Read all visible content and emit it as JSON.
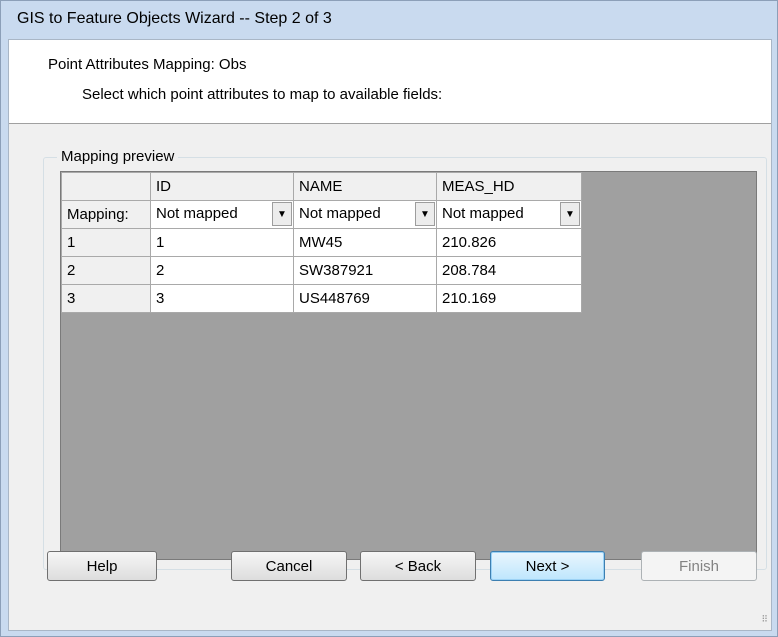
{
  "window": {
    "title": "GIS to Feature Objects Wizard -- Step 2 of 3"
  },
  "header": {
    "heading": "Point Attributes Mapping:  Obs",
    "subheading": "Select which point attributes to map to available fields:"
  },
  "group": {
    "label": "Mapping preview"
  },
  "grid": {
    "columns": [
      "",
      "ID",
      "NAME",
      "MEAS_HD"
    ],
    "mapping_label": "Mapping:",
    "mapping_values": [
      "Not mapped",
      "Not mapped",
      "Not mapped"
    ],
    "rows": [
      [
        "1",
        "1",
        "MW45",
        "210.826"
      ],
      [
        "2",
        "2",
        "SW387921",
        "208.784"
      ],
      [
        "3",
        "3",
        "US448769",
        "210.169"
      ]
    ]
  },
  "buttons": {
    "help": "Help",
    "cancel": "Cancel",
    "back": "< Back",
    "next": "Next >",
    "finish": "Finish"
  },
  "icons": {
    "dropdown": "chevron-down-icon",
    "resize": "resize-grip-icon"
  }
}
